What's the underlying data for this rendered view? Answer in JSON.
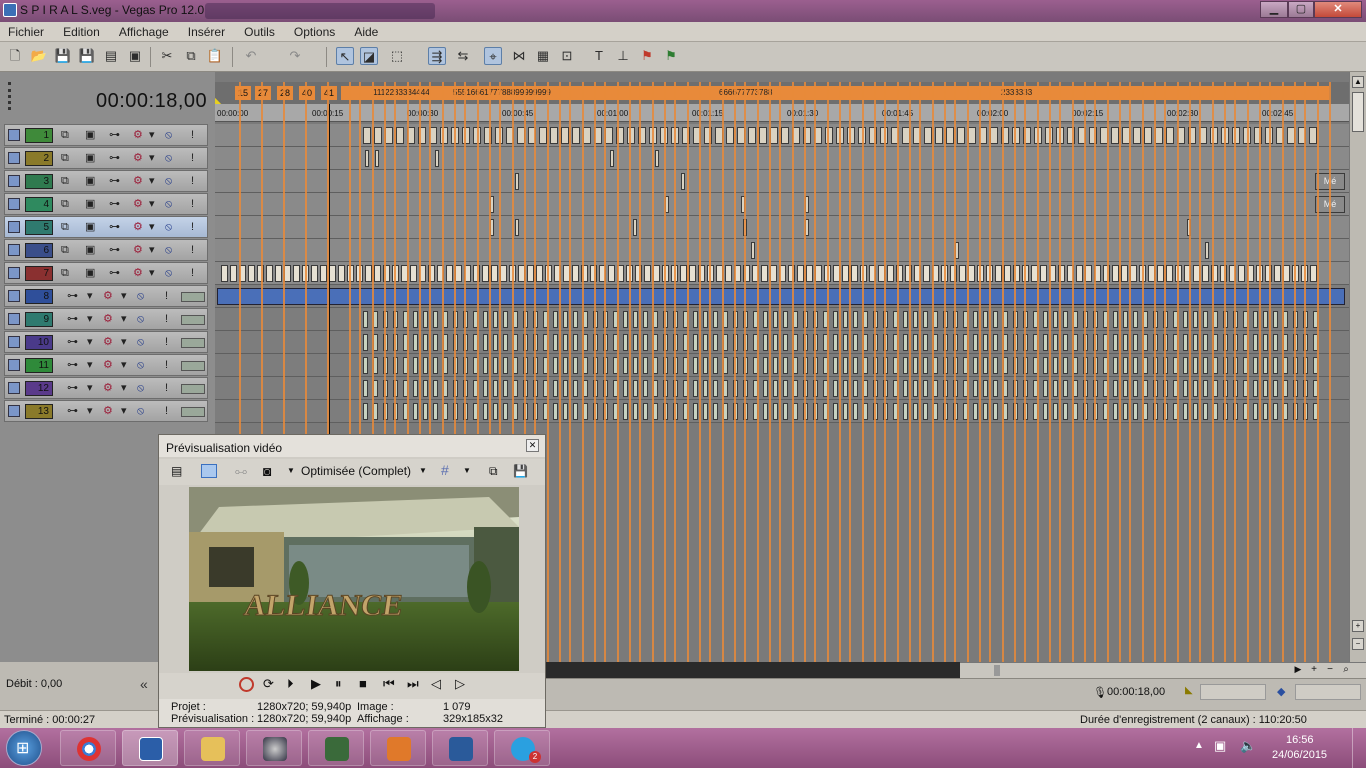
{
  "window": {
    "title": "S P I R A L S.veg - Vegas Pro 12.0",
    "min": "▁",
    "max": "▢",
    "close": "✕"
  },
  "menu": [
    "Fichier",
    "Edition",
    "Affichage",
    "Insérer",
    "Outils",
    "Options",
    "Aide"
  ],
  "timecode": "00:00:18,00",
  "tracks": [
    {
      "num": "1",
      "color": "#3f8a3a",
      "kind": "video"
    },
    {
      "num": "2",
      "color": "#8a7a2a",
      "kind": "video"
    },
    {
      "num": "3",
      "color": "#2f7a4f",
      "kind": "video"
    },
    {
      "num": "4",
      "color": "#2f8a5f",
      "kind": "video"
    },
    {
      "num": "5",
      "color": "#2f7a6f",
      "kind": "video",
      "selected": true
    },
    {
      "num": "6",
      "color": "#3a4e8a",
      "kind": "video"
    },
    {
      "num": "7",
      "color": "#8a3030",
      "kind": "video"
    },
    {
      "num": "8",
      "color": "#2f4f9a",
      "kind": "audio"
    },
    {
      "num": "9",
      "color": "#2f7a6f",
      "kind": "audio"
    },
    {
      "num": "10",
      "color": "#4a3a8a",
      "kind": "audio"
    },
    {
      "num": "11",
      "color": "#2f8a3a",
      "kind": "audio"
    },
    {
      "num": "12",
      "color": "#5a3a8a",
      "kind": "audio"
    },
    {
      "num": "13",
      "color": "#8a7a2a",
      "kind": "audio"
    }
  ],
  "markers": [
    "15",
    "27",
    "28",
    "40",
    "41"
  ],
  "marker_text": [
    "1112233334444",
    "5551666177788899999999",
    "666677773788",
    "2333333"
  ],
  "ruler": [
    "00:00:00",
    "00:00:15",
    "00:00:30",
    "00:00:45",
    "00:01:00",
    "00:01:15",
    "00:01:30",
    "00:01:45",
    "00:02:00",
    "00:02:15",
    "00:02:30",
    "00:02:45"
  ],
  "clip_labels": {
    "gen": "Mé",
    "gen2": "Mé"
  },
  "preview": {
    "title": "Prévisualisation vidéo",
    "quality": "Optimisée (Complet)",
    "image_text": "ALLIANCE",
    "projet_label": "Projet :",
    "projet_value": "1280x720; 59,940p",
    "prev_label": "Prévisualisation :",
    "prev_value": "1280x720; 59,940p",
    "image_label": "Image :",
    "image_value": "1 079",
    "affichage_label": "Affichage :",
    "affichage_value": "329x185x32"
  },
  "debit": "Débit : 0,00",
  "status_left": "Terminé : 00:00:27",
  "status_right": "Durée d'enregistrement (2 canaux) : 110:20:50",
  "cursor_time": "00:00:18,00",
  "clock": {
    "time": "16:56",
    "date": "24/06/2015"
  },
  "badge": "2"
}
